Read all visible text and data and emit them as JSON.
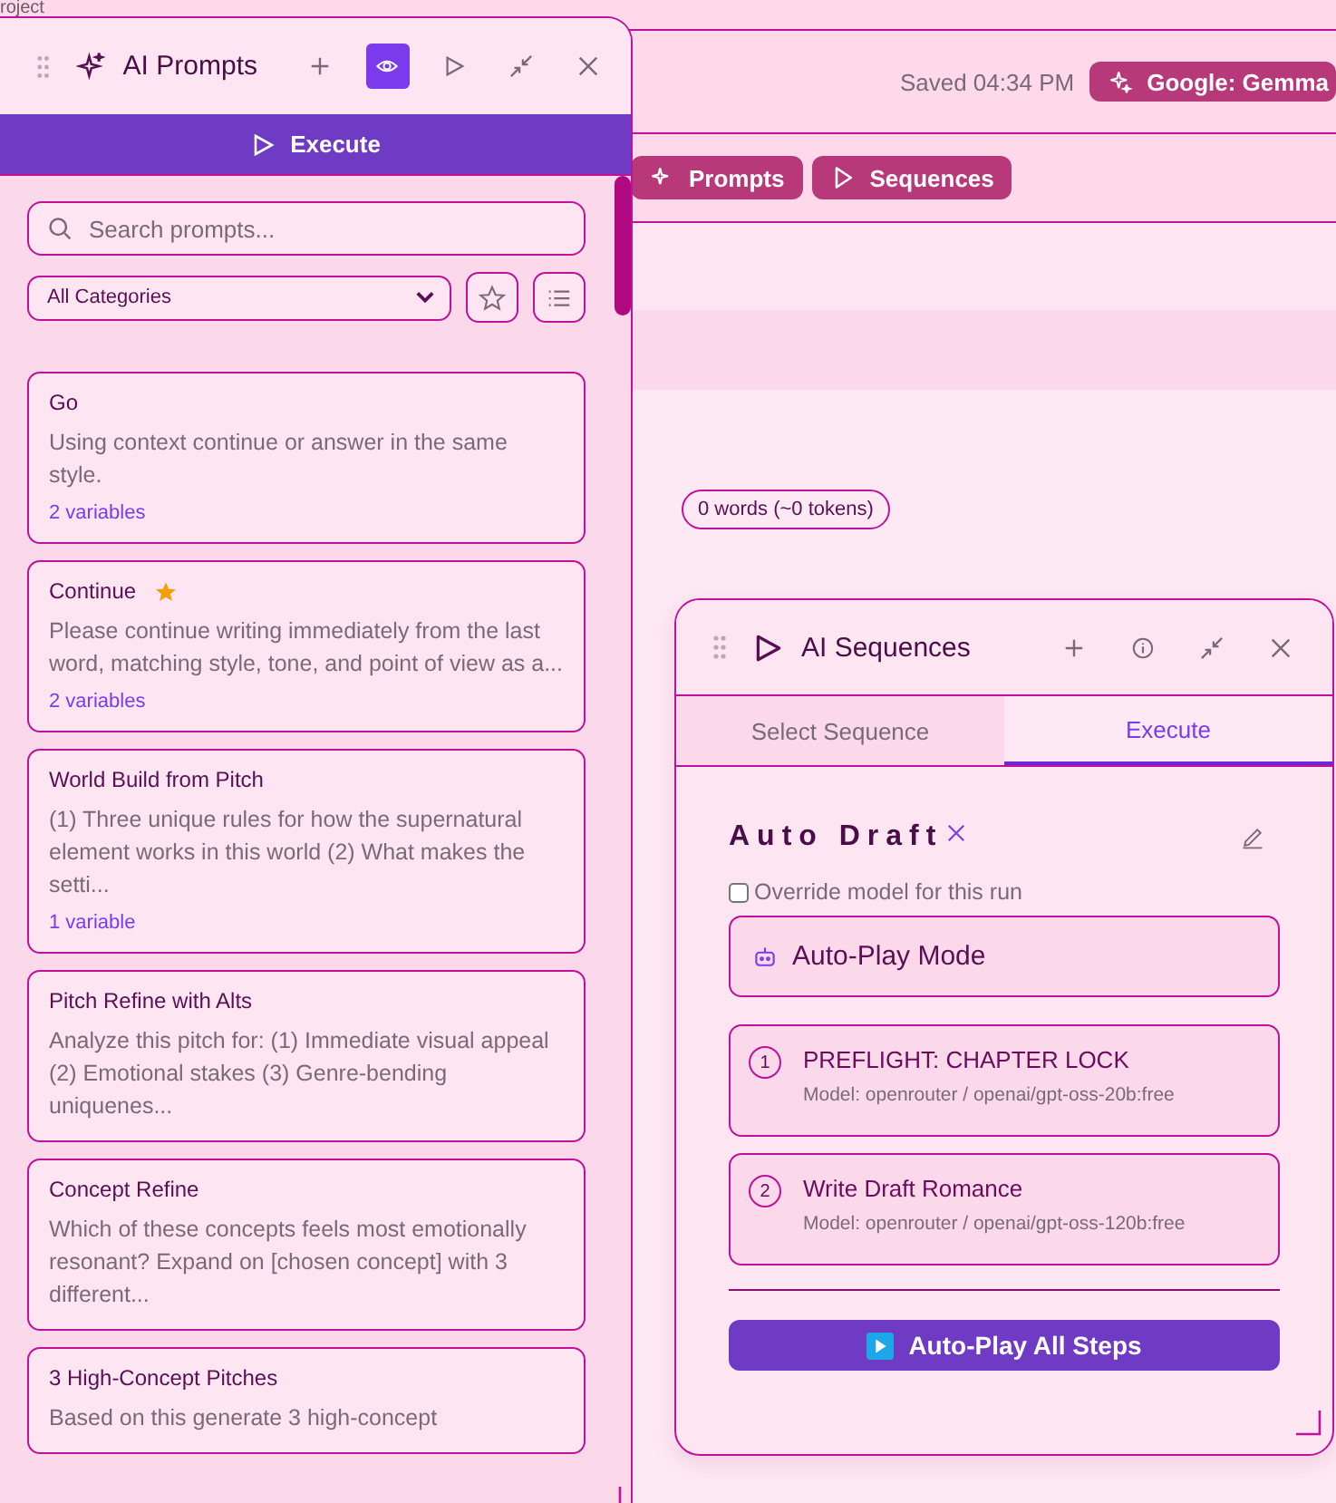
{
  "background": {
    "breadcrumb": "roject",
    "save_status": "Saved 04:34 PM",
    "model_badge": "Google: Gemma",
    "toolbar": [
      {
        "label": "Prompts"
      },
      {
        "label": "Sequences"
      }
    ],
    "word_count": "0 words (~0 tokens)"
  },
  "prompts_panel": {
    "title": "AI Prompts",
    "preview_active": true,
    "execute_label": "Execute",
    "search": {
      "placeholder": "Search prompts..."
    },
    "category": "All Categories",
    "prompts": [
      {
        "title": "Go",
        "favorite": false,
        "text": "Using context continue or answer in the same style.",
        "variables": "2 variables"
      },
      {
        "title": "Continue",
        "favorite": true,
        "text": "Please continue writing immediately from the last word, matching style, tone, and point of view as a...",
        "variables": "2 variables"
      },
      {
        "title": "World Build from Pitch",
        "favorite": false,
        "text": "(1) Three unique rules for how the supernatural element works in this world (2) What makes the setti...",
        "variables": "1 variable"
      },
      {
        "title": "Pitch Refine with Alts",
        "favorite": false,
        "text": "Analyze this pitch for: (1) Immediate visual appeal (2) Emotional stakes (3) Genre-bending uniquenes..."
      },
      {
        "title": "Concept Refine",
        "favorite": false,
        "text": "Which of these concepts feels most emotionally resonant? Expand on [chosen concept] with 3 different..."
      },
      {
        "title": "3 High-Concept Pitches",
        "favorite": false,
        "text": "Based on this generate 3 high-concept"
      }
    ]
  },
  "sequences_panel": {
    "title": "AI Sequences",
    "tabs": [
      {
        "label": "Select Sequence",
        "selected": false
      },
      {
        "label": "Execute",
        "selected": true
      }
    ],
    "sequence_name": "Auto Draft",
    "override": {
      "label": "Override model for this run",
      "checked": false
    },
    "mode": "Auto-Play Mode",
    "steps": [
      {
        "number": "1",
        "name": "PREFLIGHT: CHAPTER LOCK",
        "model": "Model: openrouter / openai/gpt-oss-20b:free"
      },
      {
        "number": "2",
        "name": "Write Draft Romance",
        "model": "Model: openrouter / openai/gpt-oss-120b:free"
      }
    ],
    "run_button": "Auto-Play All Steps"
  }
}
